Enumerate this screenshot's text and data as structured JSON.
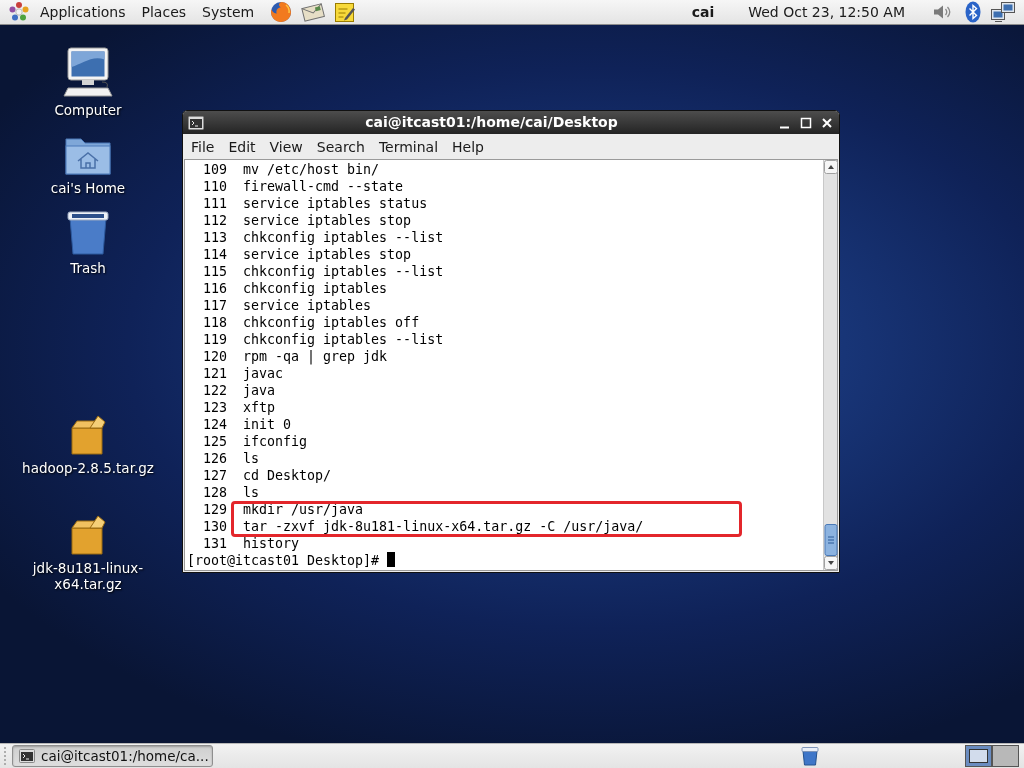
{
  "top_panel": {
    "menus": [
      "Applications",
      "Places",
      "System"
    ],
    "user": "cai",
    "clock": "Wed Oct 23, 12:50 AM"
  },
  "desktop_icons": [
    {
      "label": "Computer",
      "kind": "computer"
    },
    {
      "label": "cai's Home",
      "kind": "home"
    },
    {
      "label": "Trash",
      "kind": "trash"
    },
    {
      "label": "hadoop-2.8.5.tar.gz",
      "kind": "archive"
    },
    {
      "label": "jdk-8u181-linux-x64.tar.gz",
      "kind": "archive"
    }
  ],
  "terminal": {
    "title": "cai@itcast01:/home/cai/Desktop",
    "menu": [
      "File",
      "Edit",
      "View",
      "Search",
      "Terminal",
      "Help"
    ],
    "history": [
      {
        "number": "109",
        "command": "mv /etc/host bin/",
        "highlighted": false
      },
      {
        "number": "110",
        "command": "firewall-cmd --state",
        "highlighted": false
      },
      {
        "number": "111",
        "command": "service iptables status",
        "highlighted": false
      },
      {
        "number": "112",
        "command": "service iptables stop",
        "highlighted": false
      },
      {
        "number": "113",
        "command": "chkconfig iptables --list",
        "highlighted": false
      },
      {
        "number": "114",
        "command": "service iptables stop",
        "highlighted": false
      },
      {
        "number": "115",
        "command": "chkconfig iptables --list",
        "highlighted": false
      },
      {
        "number": "116",
        "command": "chkconfig iptables",
        "highlighted": false
      },
      {
        "number": "117",
        "command": "service iptables",
        "highlighted": false
      },
      {
        "number": "118",
        "command": "chkconfig iptables off",
        "highlighted": false
      },
      {
        "number": "119",
        "command": "chkconfig iptables --list",
        "highlighted": false
      },
      {
        "number": "120",
        "command": "rpm -qa | grep jdk",
        "highlighted": false
      },
      {
        "number": "121",
        "command": "javac",
        "highlighted": false
      },
      {
        "number": "122",
        "command": "java",
        "highlighted": false
      },
      {
        "number": "123",
        "command": "xftp",
        "highlighted": false
      },
      {
        "number": "124",
        "command": "init 0",
        "highlighted": false
      },
      {
        "number": "125",
        "command": "ifconfig",
        "highlighted": false
      },
      {
        "number": "126",
        "command": "ls",
        "highlighted": false
      },
      {
        "number": "127",
        "command": "cd Desktop/",
        "highlighted": false
      },
      {
        "number": "128",
        "command": "ls",
        "highlighted": false
      },
      {
        "number": "129",
        "command": "mkdir /usr/java",
        "highlighted": true
      },
      {
        "number": "130",
        "command": "tar -zxvf jdk-8u181-linux-x64.tar.gz -C /usr/java/",
        "highlighted": true
      },
      {
        "number": "131",
        "command": "history",
        "highlighted": false
      }
    ],
    "prompt": "[root@itcast01 Desktop]#"
  },
  "taskbar": {
    "tasks": [
      {
        "label": "cai@itcast01:/home/ca...",
        "selected": true
      }
    ]
  }
}
